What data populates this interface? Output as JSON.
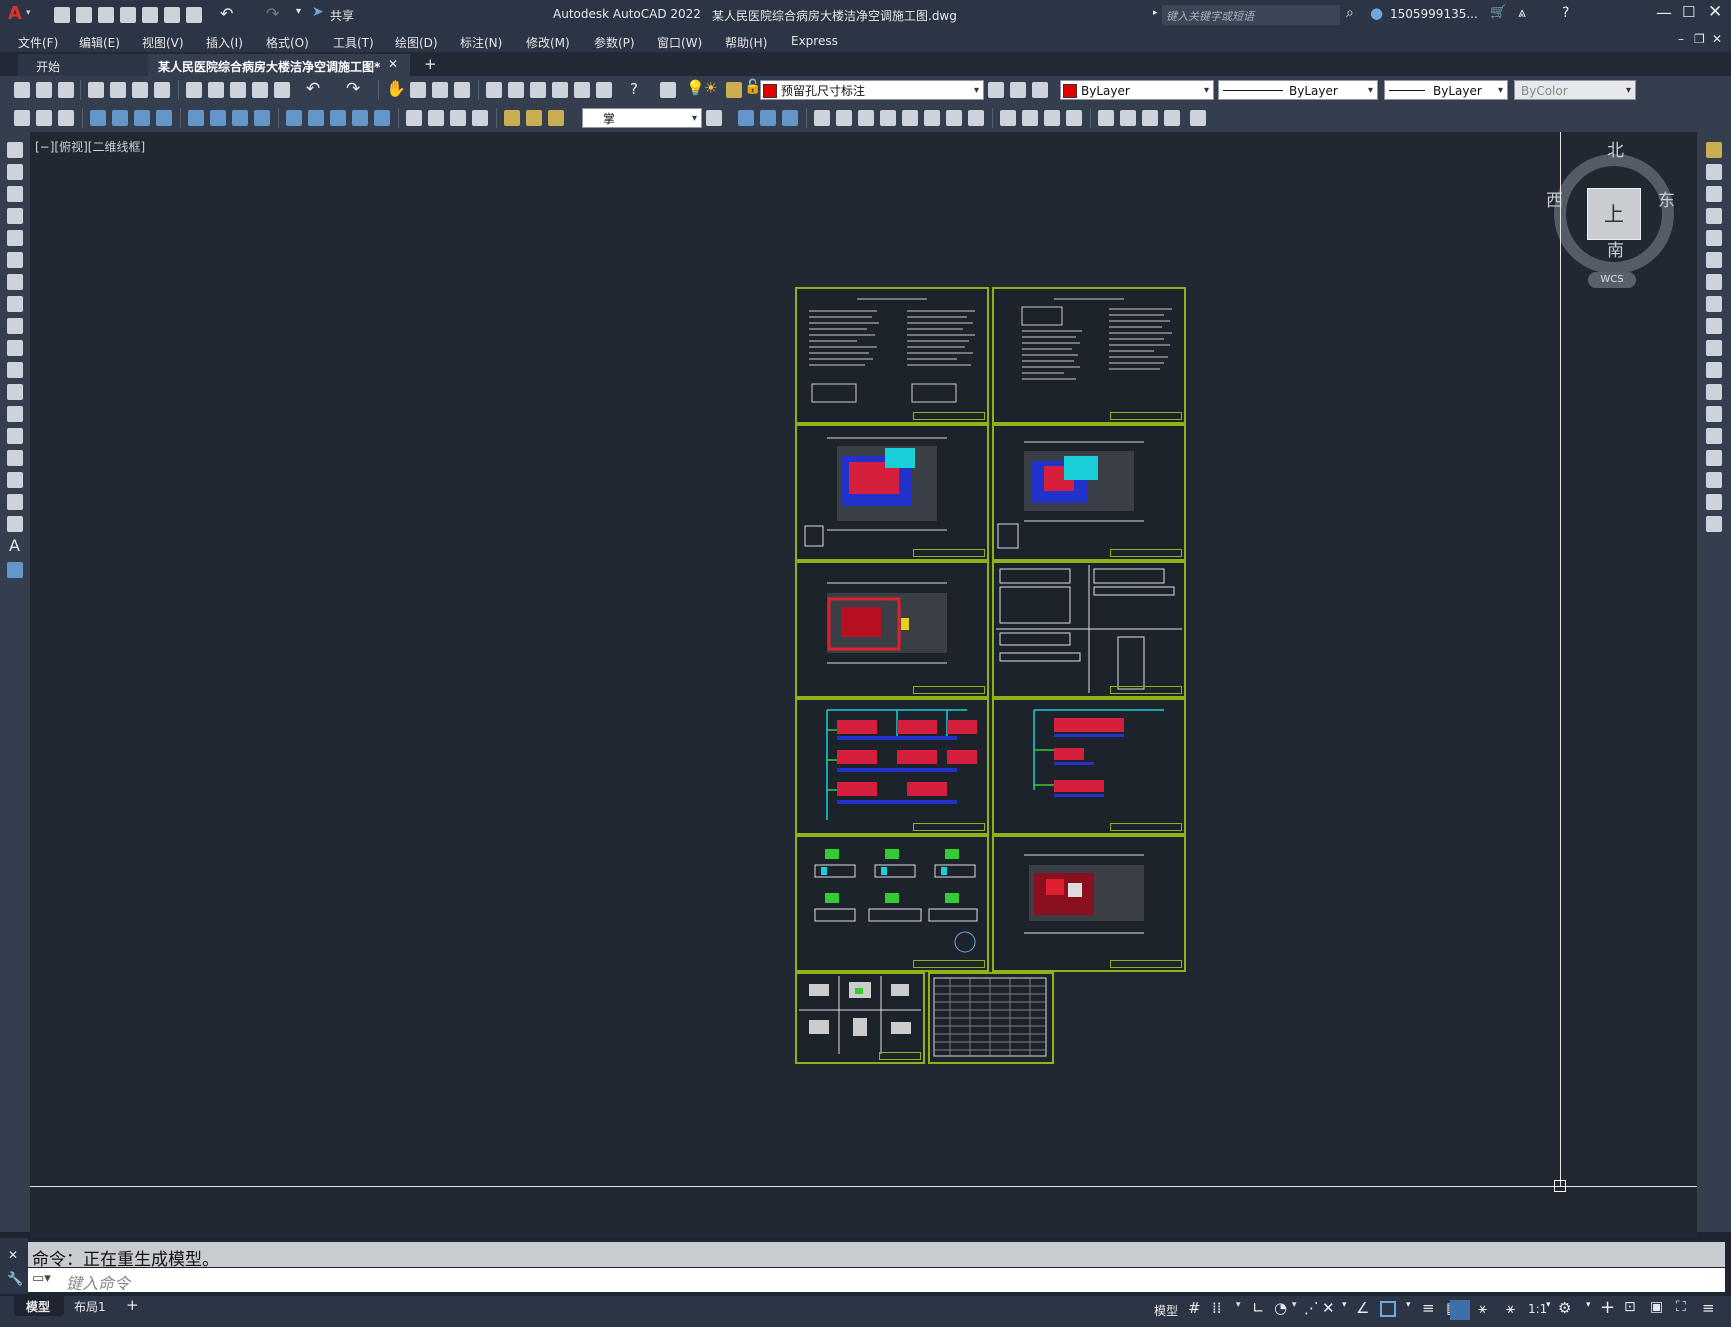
{
  "app": {
    "title": "Autodesk AutoCAD 2022",
    "filename": "某人民医院综合病房大楼洁净空调施工图.dwg",
    "logo": "A",
    "share_label": "共享",
    "search_placeholder": "键入关键字或短语",
    "user": "1505999135...",
    "window_controls": [
      "minimize-icon",
      "maximize-icon",
      "close-icon"
    ]
  },
  "menu": [
    "文件(F)",
    "编辑(E)",
    "视图(V)",
    "插入(I)",
    "格式(O)",
    "工具(T)",
    "绘图(D)",
    "标注(N)",
    "修改(M)",
    "参数(P)",
    "窗口(W)",
    "帮助(H)",
    "Express"
  ],
  "tabs": [
    {
      "label": "开始",
      "active": false
    },
    {
      "label": "某人民医院综合病房大楼洁净空调施工图*",
      "active": true
    }
  ],
  "toolbar": {
    "layer_name": "预留孔尺寸标注",
    "layer_color": "#e00000",
    "color_value": "ByLayer",
    "linetype_value": "ByLayer",
    "lineweight_value": "ByLayer",
    "plotstyle_value": "ByColor",
    "dimstyle_value": "掌"
  },
  "viewport": {
    "label": "[−][俯视][二维线框]",
    "viewcube": {
      "north": "北",
      "south": "南",
      "east": "东",
      "west": "西",
      "top": "上",
      "wcs": "WCS"
    }
  },
  "command": {
    "history": "命令：正在重生成模型。",
    "placeholder": "键入命令"
  },
  "status": {
    "layout_tabs": [
      "模型",
      "布局1"
    ],
    "model_label": "模型",
    "scale": "1:1"
  },
  "colors": {
    "accent_green": "#8db318",
    "canvas_bg": "#212831",
    "ui_bg": "#2c3545"
  }
}
